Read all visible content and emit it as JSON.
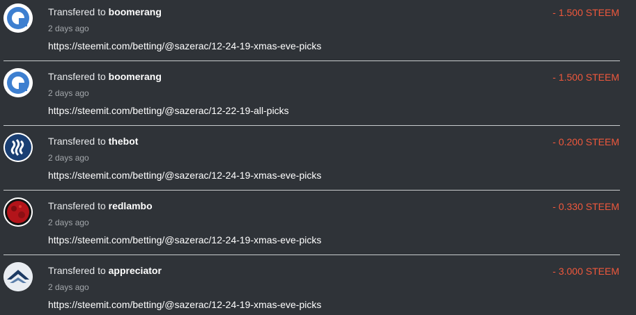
{
  "colors": {
    "background": "#2f3338",
    "amount_negative": "#f0583c",
    "divider": "#c9ccce"
  },
  "transfers": [
    {
      "prefix": "Transfered to",
      "recipient": "boomerang",
      "time": "2 days ago",
      "memo": "https://steemit.com/betting/@sazerac/12-24-19-xmas-eve-picks",
      "amount": "- 1.500 STEEM",
      "avatar_icon": "boomerang-avatar-icon"
    },
    {
      "prefix": "Transfered to",
      "recipient": "boomerang",
      "time": "2 days ago",
      "memo": "https://steemit.com/betting/@sazerac/12-22-19-all-picks",
      "amount": "- 1.500 STEEM",
      "avatar_icon": "boomerang-avatar-icon"
    },
    {
      "prefix": "Transfered to",
      "recipient": "thebot",
      "time": "2 days ago",
      "memo": "https://steemit.com/betting/@sazerac/12-24-19-xmas-eve-picks",
      "amount": "- 0.200 STEEM",
      "avatar_icon": "steem-logo-avatar-icon"
    },
    {
      "prefix": "Transfered to",
      "recipient": "redlambo",
      "time": "2 days ago",
      "memo": "https://steemit.com/betting/@sazerac/12-24-19-xmas-eve-picks",
      "amount": "- 0.330 STEEM",
      "avatar_icon": "red-moon-avatar-icon"
    },
    {
      "prefix": "Transfered to",
      "recipient": "appreciator",
      "time": "2 days ago",
      "memo": "https://steemit.com/betting/@sazerac/12-24-19-xmas-eve-picks",
      "amount": "- 3.000 STEEM",
      "avatar_icon": "appreciator-avatar-icon"
    }
  ]
}
